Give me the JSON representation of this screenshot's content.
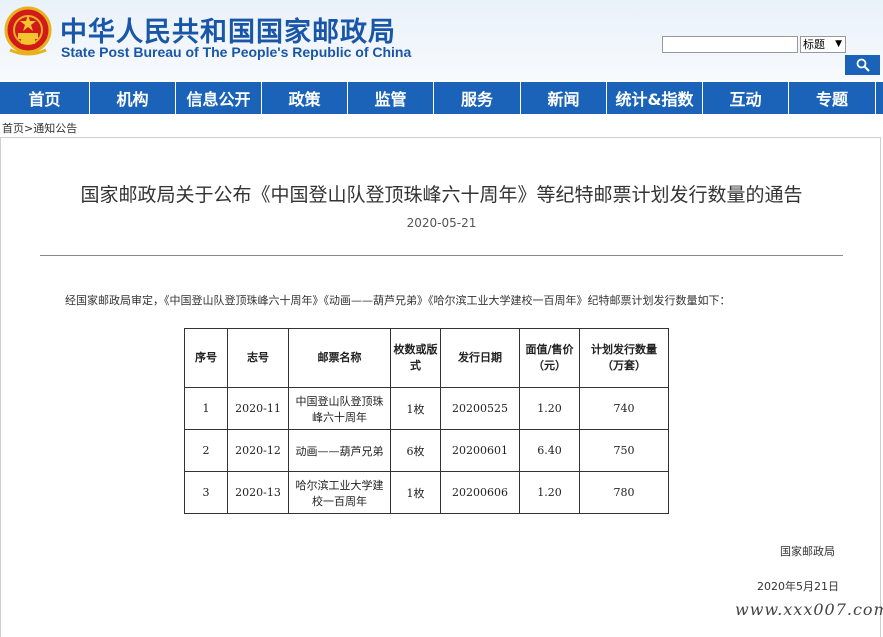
{
  "header": {
    "title_cn": "中华人民共和国国家邮政局",
    "title_en": "State Post Bureau of The People's Republic of China",
    "emblem_icon": "national-emblem-icon",
    "search": {
      "placeholder": "",
      "scope_selected": "标题",
      "button_icon": "search-icon"
    },
    "colors": {
      "brand_blue": "#1a63b8",
      "title_blue": "#1a56a8"
    }
  },
  "nav": {
    "items": [
      "首页",
      "机构",
      "信息公开",
      "政策",
      "监管",
      "服务",
      "新闻",
      "统计&指数",
      "互动",
      "专题"
    ]
  },
  "breadcrumb": {
    "home": "首页",
    "sep": ">",
    "current": "通知公告"
  },
  "article": {
    "title": "国家邮政局关于公布《中国登山队登顶珠峰六十周年》等纪特邮票计划发行数量的通告",
    "date": "2020-05-21",
    "intro": "经国家邮政局审定，《中国登山队登顶珠峰六十周年》《动画——葫芦兄弟》《哈尔滨工业大学建校一百周年》纪特邮票计划发行数量如下：",
    "table": {
      "headers": [
        "序号",
        "志号",
        "邮票名称",
        "枚数或版式",
        "发行日期",
        "面值/售价（元）",
        "计划发行数量（万套）"
      ],
      "rows": [
        [
          "1",
          "2020-11",
          "中国登山队登顶珠峰六十周年",
          "1枚",
          "20200525",
          "1.20",
          "740"
        ],
        [
          "2",
          "2020-12",
          "动画——葫芦兄弟",
          "6枚",
          "20200601",
          "6.40",
          "750"
        ],
        [
          "3",
          "2020-13",
          "哈尔滨工业大学建校一百周年",
          "1枚",
          "20200606",
          "1.20",
          "780"
        ]
      ]
    },
    "signer": "国家邮政局",
    "sign_date": "2020年5月21日"
  },
  "watermark": "www.xxx007.com"
}
